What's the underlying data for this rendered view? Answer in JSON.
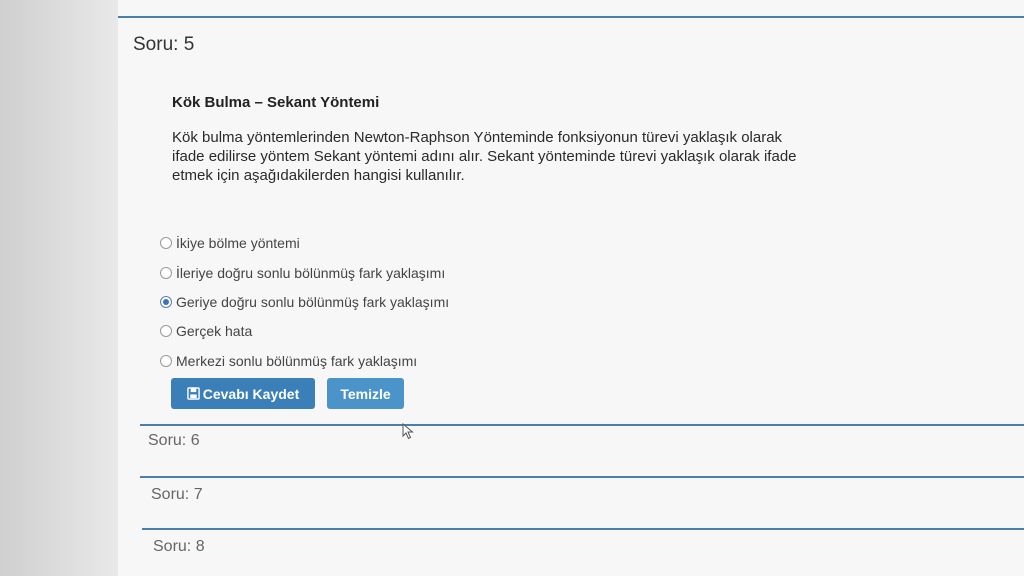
{
  "current_question": {
    "title": "Soru: 5",
    "heading": "Kök Bulma – Sekant Yöntemi",
    "text_lines": [
      "Kök bulma yöntemlerinden Newton-Raphson Yönteminde fonksiyonun türevi yaklaşık olarak",
      "ifade edilirse yöntem Sekant yöntemi adını alır. Sekant yönteminde türevi yaklaşık olarak ifade",
      "etmek için aşağıdakilerden hangisi kullanılır."
    ],
    "options": [
      {
        "label": "İkiye bölme yöntemi",
        "selected": false
      },
      {
        "label": "İleriye doğru sonlu bölünmüş fark yaklaşımı",
        "selected": false
      },
      {
        "label": "Geriye doğru sonlu bölünmüş fark yaklaşımı",
        "selected": true
      },
      {
        "label": "Gerçek hata",
        "selected": false
      },
      {
        "label": "Merkezi sonlu bölünmüş fark yaklaşımı",
        "selected": false
      }
    ],
    "buttons": {
      "save_label": "Cevabı Kaydet",
      "save_icon": "floppy-disk-icon",
      "clear_label": "Temizle"
    }
  },
  "other_questions": [
    {
      "title": "Soru: 6"
    },
    {
      "title": "Soru: 7"
    },
    {
      "title": "Soru: 8"
    }
  ],
  "colors": {
    "accent": "#4a7fa8",
    "save_button": "#3b7fb9",
    "clear_button": "#4b94c9"
  }
}
